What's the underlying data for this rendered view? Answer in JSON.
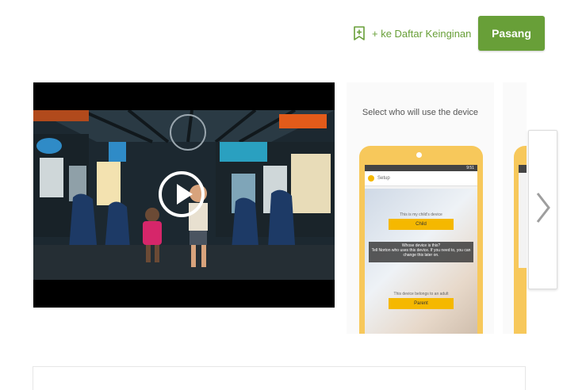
{
  "header": {
    "wishlist_label": "+ ke Daftar Keinginan",
    "install_label": "Pasang"
  },
  "screenshots": [
    {
      "caption": "Select who will use the device",
      "status_time": "9:51",
      "appbar_title": "Setup",
      "prompt_child": "This is my child's device",
      "child_button": "Child",
      "prompt_question": "Whose device is this?",
      "prompt_explain": "Tell Norton who uses this device. If you need to, you can change this later on.",
      "prompt_parent": "This device belongs to an adult",
      "parent_button": "Parent"
    }
  ],
  "icons": {
    "wishlist": "bookmark-add-icon",
    "play": "play-icon",
    "next": "chevron-right-icon"
  },
  "colors": {
    "accent": "#689f38",
    "phone": "#f7c85b"
  }
}
